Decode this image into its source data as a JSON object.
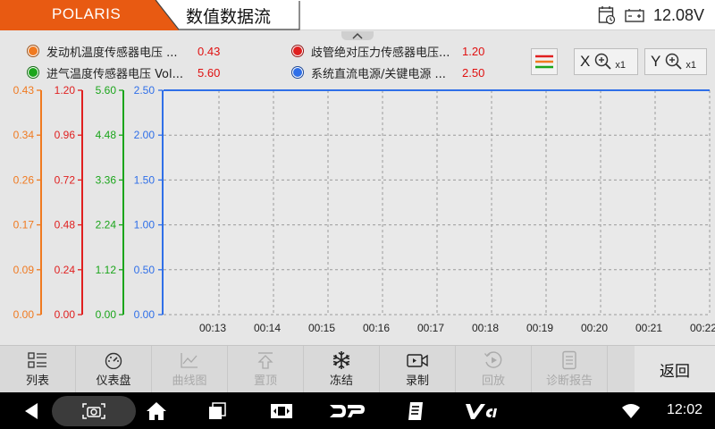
{
  "header": {
    "brand": "POLARIS",
    "title": "数值数据流",
    "voltage": "12.08V",
    "icons": [
      "calendar-clock-icon",
      "battery-icon"
    ]
  },
  "legend": [
    {
      "name": "发动机温度传感器电压 ...",
      "value": "0.43",
      "color": "#f07a20"
    },
    {
      "name": "进气温度传感器电压  Vol...",
      "value": "5.60",
      "color": "#1ba51b"
    },
    {
      "name": "歧管绝对压力传感器电压...",
      "value": "1.20",
      "color": "#e02020"
    },
    {
      "name": "系统直流电源/关键电源  ...",
      "value": "2.50",
      "color": "#2f6fe8"
    }
  ],
  "controls": {
    "x_zoom": {
      "axis": "X",
      "mult": "x1"
    },
    "y_zoom": {
      "axis": "Y",
      "mult": "x1"
    }
  },
  "chart_data": {
    "type": "line",
    "axes": [
      {
        "name": "发动机温度传感器电压",
        "color": "#f07a20",
        "ylim": [
          0,
          0.43
        ],
        "ticks": [
          "0.43",
          "0.34",
          "0.26",
          "0.17",
          "0.09",
          "0.00"
        ]
      },
      {
        "name": "歧管绝对压力传感器电压",
        "color": "#e02020",
        "ylim": [
          0,
          1.2
        ],
        "ticks": [
          "1.20",
          "0.96",
          "0.72",
          "0.48",
          "0.24",
          "0.00"
        ]
      },
      {
        "name": "进气温度传感器电压",
        "color": "#1ba51b",
        "ylim": [
          0,
          5.6
        ],
        "ticks": [
          "5.60",
          "4.48",
          "3.36",
          "2.24",
          "1.12",
          "0.00"
        ]
      },
      {
        "name": "系统直流电源/关键电源",
        "color": "#2f6fe8",
        "ylim": [
          0,
          2.5
        ],
        "ticks": [
          "2.50",
          "2.00",
          "1.50",
          "1.00",
          "0.50",
          "0.00"
        ]
      }
    ],
    "x_ticks": [
      "00:13",
      "00:14",
      "00:15",
      "00:16",
      "00:17",
      "00:18",
      "00:19",
      "00:20",
      "00:21",
      "00:22"
    ],
    "series": [
      {
        "name": "系统直流电源/关键电源",
        "color": "#2f6fe8",
        "value": 2.5
      }
    ],
    "grid": true
  },
  "toolbar": [
    {
      "label": "列表",
      "icon": "list-icon",
      "enabled": true
    },
    {
      "label": "仪表盘",
      "icon": "gauge-icon",
      "enabled": true
    },
    {
      "label": "曲线图",
      "icon": "line-chart-icon",
      "enabled": false
    },
    {
      "label": "置顶",
      "icon": "pin-top-icon",
      "enabled": false
    },
    {
      "label": "冻结",
      "icon": "snowflake-icon",
      "enabled": true
    },
    {
      "label": "录制",
      "icon": "record-icon",
      "enabled": true
    },
    {
      "label": "回放",
      "icon": "playback-icon",
      "enabled": false
    },
    {
      "label": "诊断报告",
      "icon": "report-icon",
      "enabled": false
    }
  ],
  "back_label": "返回",
  "navbar": {
    "time": "12:02",
    "icons": [
      "back-icon",
      "screenshot-icon",
      "home-icon",
      "recent-apps-icon",
      "vci-switch-icon",
      "dp-logo-icon",
      "notes-icon",
      "vci-logo-icon",
      "wifi-icon"
    ]
  }
}
